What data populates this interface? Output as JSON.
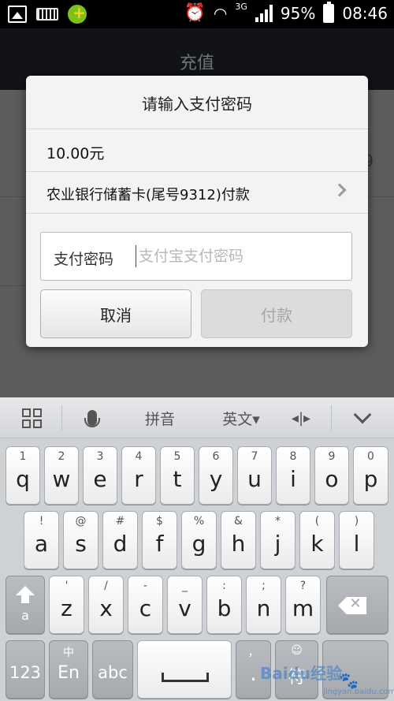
{
  "status_bar": {
    "left_icons": [
      "photo-icon",
      "keyboard-icon",
      "app-badge-icon"
    ],
    "network": "3G",
    "battery": "95%",
    "time": "08:46"
  },
  "background_app": {
    "title": "充值",
    "fragment": "9"
  },
  "dialog": {
    "title": "请输入支付密码",
    "amount": "10.00元",
    "payment_method": "农业银行储蓄卡(尾号9312)付款",
    "password_label": "支付密码",
    "password_placeholder": "支付宝支付密码",
    "cancel_label": "取消",
    "pay_label": "付款"
  },
  "keyboard": {
    "toolbar": {
      "pinyin": "拼音",
      "language": "英文▾"
    },
    "row1": [
      {
        "num": "1",
        "ch": "q"
      },
      {
        "num": "2",
        "ch": "w"
      },
      {
        "num": "3",
        "ch": "e"
      },
      {
        "num": "4",
        "ch": "r"
      },
      {
        "num": "5",
        "ch": "t"
      },
      {
        "num": "6",
        "ch": "y"
      },
      {
        "num": "7",
        "ch": "u"
      },
      {
        "num": "8",
        "ch": "i"
      },
      {
        "num": "9",
        "ch": "o"
      },
      {
        "num": "0",
        "ch": "p"
      }
    ],
    "row2": [
      {
        "num": "!",
        "ch": "a"
      },
      {
        "num": "@",
        "ch": "s"
      },
      {
        "num": "#",
        "ch": "d"
      },
      {
        "num": "$",
        "ch": "f"
      },
      {
        "num": "%",
        "ch": "g"
      },
      {
        "num": "&",
        "ch": "h"
      },
      {
        "num": "*",
        "ch": "j"
      },
      {
        "num": "(",
        "ch": "k"
      },
      {
        "num": ")",
        "ch": "l"
      }
    ],
    "row3": [
      {
        "num": "'",
        "ch": "z"
      },
      {
        "num": "/",
        "ch": "x"
      },
      {
        "num": "-",
        "ch": "c"
      },
      {
        "num": "_",
        "ch": "v"
      },
      {
        "num": ":",
        "ch": "b"
      },
      {
        "num": ";",
        "ch": "n"
      },
      {
        "num": "?",
        "ch": "m"
      }
    ],
    "shift_sub": "a",
    "bottom": {
      "num_key": "123",
      "lang_top": "中",
      "lang_main": "En",
      "abc": "abc",
      "comma_top": "，",
      "comma_main": ".",
      "emoji_top": "☺",
      "symbol_main": "符"
    }
  },
  "watermark": {
    "main": "Baidu经验",
    "sub": "jingyan.baidu.com"
  }
}
